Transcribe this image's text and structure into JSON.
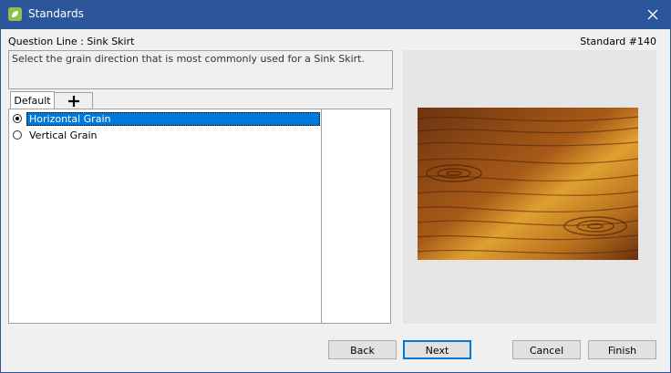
{
  "window": {
    "title": "Standards",
    "app_icon": "leaf-app-icon",
    "close_icon": "close-icon"
  },
  "question": {
    "line_label": "Question Line : Sink Skirt",
    "standard_number": "Standard #140",
    "text": "Select the grain  direction that is most commonly used for a Sink Skirt."
  },
  "tabs": {
    "default_label": "Default",
    "add_icon": "plus-icon"
  },
  "options": [
    {
      "label": "Horizontal Grain",
      "checked": true
    },
    {
      "label": "Vertical Grain",
      "checked": false
    }
  ],
  "image": {
    "description_icon": "wood-grain-image"
  },
  "buttons": {
    "back": "Back",
    "next": "Next",
    "cancel": "Cancel",
    "finish": "Finish"
  },
  "colors": {
    "titlebar": "#2b579a",
    "selection": "#0078d7",
    "wood_dark": "#5a2a08",
    "wood_light": "#e8a42c"
  }
}
